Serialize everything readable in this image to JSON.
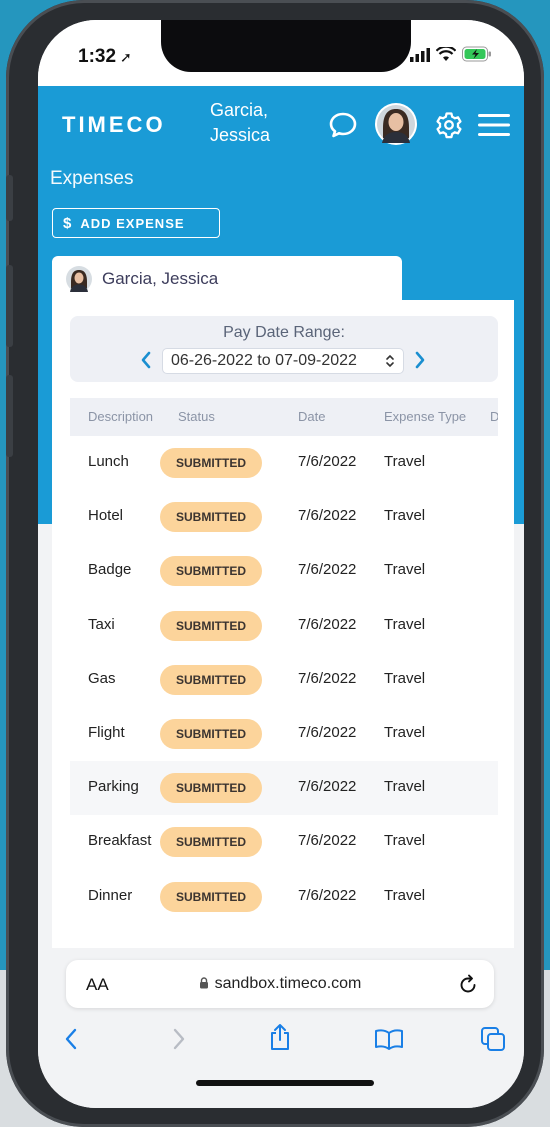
{
  "status_bar": {
    "time": "1:32"
  },
  "header": {
    "logo": "TIMECO",
    "user_name": "Garcia, Jessica"
  },
  "page": {
    "title": "Expenses",
    "add_expense_label": "ADD EXPENSE",
    "add_expense_icon": "$"
  },
  "employee_tab": {
    "name": "Garcia, Jessica"
  },
  "pay_date": {
    "label": "Pay Date Range:",
    "range": "06-26-2022 to 07-09-2022"
  },
  "table": {
    "columns": [
      "Description",
      "Status",
      "Date",
      "Expense Type",
      "D"
    ],
    "rows": [
      {
        "description": "Lunch",
        "status": "SUBMITTED",
        "date": "7/6/2022",
        "type": "Travel"
      },
      {
        "description": "Hotel",
        "status": "SUBMITTED",
        "date": "7/6/2022",
        "type": "Travel"
      },
      {
        "description": "Badge",
        "status": "SUBMITTED",
        "date": "7/6/2022",
        "type": "Travel"
      },
      {
        "description": "Taxi",
        "status": "SUBMITTED",
        "date": "7/6/2022",
        "type": "Travel"
      },
      {
        "description": "Gas",
        "status": "SUBMITTED",
        "date": "7/6/2022",
        "type": "Travel"
      },
      {
        "description": "Flight",
        "status": "SUBMITTED",
        "date": "7/6/2022",
        "type": "Travel"
      },
      {
        "description": "Parking",
        "status": "SUBMITTED",
        "date": "7/6/2022",
        "type": "Travel"
      },
      {
        "description": "Breakfast",
        "status": "SUBMITTED",
        "date": "7/6/2022",
        "type": "Travel"
      },
      {
        "description": "Dinner",
        "status": "SUBMITTED",
        "date": "7/6/2022",
        "type": "Travel"
      }
    ]
  },
  "browser": {
    "text_size_label": "AA",
    "url": "sandbox.timeco.com"
  },
  "colors": {
    "brand_blue": "#1a9bd6",
    "badge_submitted": "#fcd49b"
  }
}
